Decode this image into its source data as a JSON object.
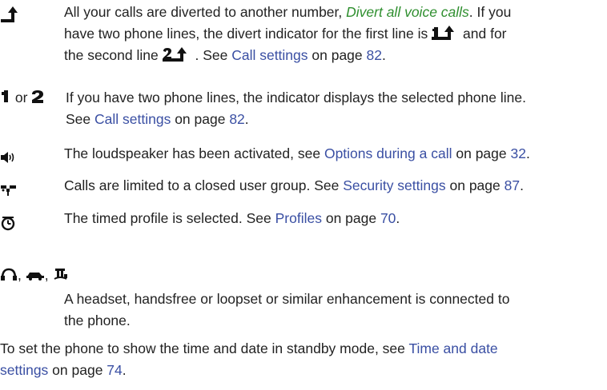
{
  "divert": {
    "line1": "All your calls are diverted to another number, ",
    "divert_link": "Divert all voice calls",
    "line1_end": ". If you",
    "line2": "have two phone lines, the divert indicator for the first line is ",
    "line2_end": " and for",
    "line3_start": "the second line ",
    "line3_mid": ". See ",
    "link": "Call settings",
    "on_page": " on page ",
    "page": "82",
    "period": "."
  },
  "lines": {
    "or": "or",
    "text1": "If you have two phone lines, the indicator displays the selected phone line.",
    "see": "See ",
    "link": "Call settings",
    "on_page": " on page ",
    "page": "82",
    "period": "."
  },
  "speaker": {
    "text": "The loudspeaker has been activated, see ",
    "link": "Options during a call",
    "on_page": " on page ",
    "page": "32",
    "period": "."
  },
  "cug": {
    "text": "Calls are limited to a closed user group. See ",
    "link": "Security settings",
    "on_page": " on page ",
    "page": "87",
    "period": "."
  },
  "timed": {
    "text": "The timed profile is selected. See ",
    "link": "Profiles",
    "on_page": " on page ",
    "page": "70",
    "period": "."
  },
  "enhancement": {
    "sep1": ",",
    "sep2": ",",
    "text1": "A headset, handsfree or loopset or similar enhancement is connected to",
    "text2": "the phone."
  },
  "footer": {
    "text1": "To set the phone to show the time and date in standby mode, see ",
    "link1": "Time and date",
    "link2": "settings",
    "on_page": " on page ",
    "page": "74",
    "period": "."
  },
  "colors": {
    "link": "#3a4fa3",
    "emphasis_link": "#2f8f2f",
    "text": "#222222",
    "icon": "#111111"
  }
}
